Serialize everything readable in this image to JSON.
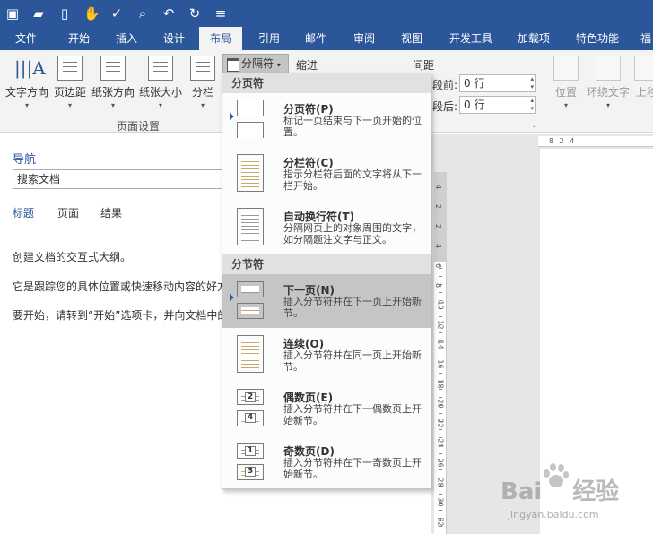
{
  "qat": {
    "icons": [
      "save-icon",
      "open-folder-icon",
      "new-document-icon",
      "touch-mode-icon",
      "spelling-check-icon",
      "print-preview-icon",
      "undo-icon",
      "redo-icon",
      "customize-icon"
    ]
  },
  "tabs": [
    "文件",
    "开始",
    "插入",
    "设计",
    "布局",
    "引用",
    "邮件",
    "审阅",
    "视图",
    "开发工具",
    "加载项",
    "特色功能",
    "福"
  ],
  "ribbon": {
    "text_direction": "文字方向",
    "margins": "页边距",
    "orientation": "纸张方向",
    "size": "纸张大小",
    "columns": "分栏",
    "group_page_setup": "页面设置",
    "breaks": "分隔符",
    "indent": "缩进",
    "spacing": "间距",
    "before_label": "段前:",
    "before_value": "0 行",
    "after_label": "段后:",
    "after_value": "0 行",
    "position": "位置",
    "wrap_text": "环绕文字",
    "bring_forward": "上移"
  },
  "nav": {
    "title": "导航",
    "search_placeholder": "搜索文档",
    "tabs": [
      "标题",
      "页面",
      "结果"
    ],
    "text1": "创建文档的交互式大纲。",
    "text2": "它是跟踪您的具体位置或快速移动内容的好方法。",
    "text3": "要开始，请转到“开始”选项卡，并向文档中的标题应用标题样式。"
  },
  "ruler": {
    "h_marks": "8   2   4",
    "v_marks": [
      "4",
      "2",
      "2",
      "4",
      "6",
      "8",
      "10",
      "12",
      "14",
      "16",
      "18",
      "20",
      "22",
      "24",
      "26",
      "28",
      "30",
      "32"
    ]
  },
  "dropdown": {
    "section1": "分页符",
    "section2": "分节符",
    "items": [
      {
        "title": "分页符(P)",
        "desc": "标记一页结束与下一页开始的位置。"
      },
      {
        "title": "分栏符(C)",
        "desc": "指示分栏符后面的文字将从下一栏开始。"
      },
      {
        "title": "自动换行符(T)",
        "desc": "分隔网页上的对象周围的文字，如分隔题注文字与正文。"
      },
      {
        "title": "下一页(N)",
        "desc": "插入分节符并在下一页上开始新节。"
      },
      {
        "title": "连续(O)",
        "desc": "插入分节符并在同一页上开始新节。"
      },
      {
        "title": "偶数页(E)",
        "desc": "插入分节符并在下一偶数页上开始新节。"
      },
      {
        "title": "奇数页(D)",
        "desc": "插入分节符并在下一奇数页上开始新节。"
      }
    ],
    "even_nums": [
      "2",
      "4"
    ],
    "odd_nums": [
      "1",
      "3"
    ]
  },
  "watermark": {
    "brand": "Bai",
    "brand2": "经验",
    "sub": "jingyan.baidu.com"
  },
  "colors": {
    "accent": "#2b579a",
    "ribbon_bg": "#f3f3f3",
    "highlight": "#c5c5c5"
  }
}
